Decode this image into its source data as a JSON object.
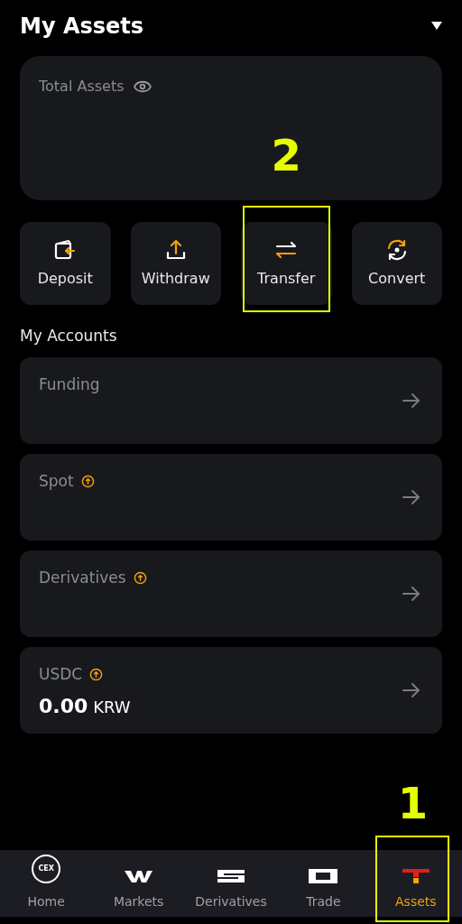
{
  "header": {
    "title": "My Assets"
  },
  "total_assets": {
    "label": "Total Assets"
  },
  "actions": [
    {
      "kind": "deposit",
      "label": "Deposit"
    },
    {
      "kind": "withdraw",
      "label": "Withdraw"
    },
    {
      "kind": "transfer",
      "label": "Transfer",
      "callout": "2"
    },
    {
      "kind": "convert",
      "label": "Convert"
    }
  ],
  "accounts_title": "My Accounts",
  "accounts": [
    {
      "name": "Funding",
      "upgrade_badge": false
    },
    {
      "name": "Spot",
      "upgrade_badge": true
    },
    {
      "name": "Derivatives",
      "upgrade_badge": true
    },
    {
      "name": "USDC",
      "upgrade_badge": true,
      "amount": "0.00",
      "currency": "KRW"
    }
  ],
  "nav": [
    {
      "kind": "home",
      "label": "Home",
      "selected": false,
      "icon_text": "CEX"
    },
    {
      "kind": "markets",
      "label": "Markets",
      "selected": false
    },
    {
      "kind": "derivatives",
      "label": "Derivatives",
      "selected": false
    },
    {
      "kind": "trade",
      "label": "Trade",
      "selected": false
    },
    {
      "kind": "assets",
      "label": "Assets",
      "selected": true,
      "callout": "1"
    }
  ]
}
